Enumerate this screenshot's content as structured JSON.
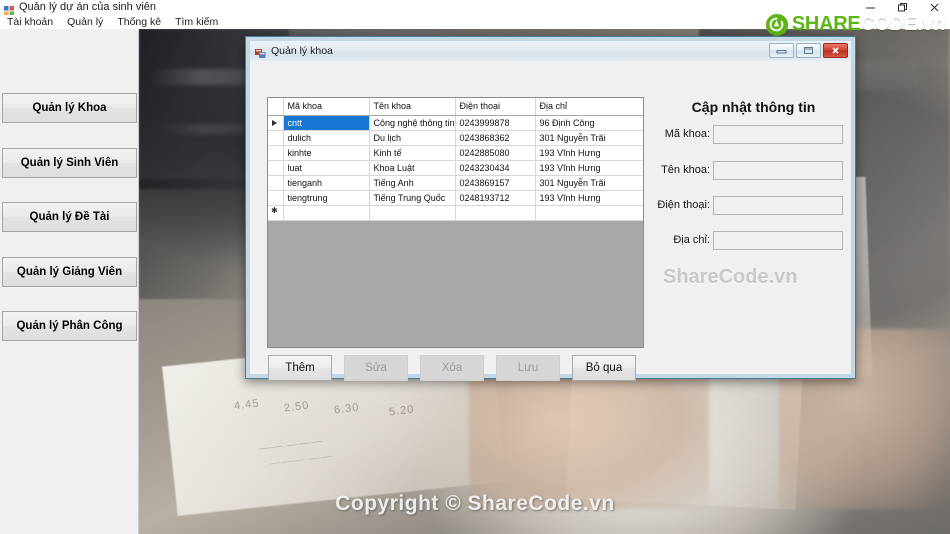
{
  "main_window": {
    "title": "Quản lý dự án của sinh viên",
    "icon": "app-icon",
    "controls": {
      "minimize": "—",
      "maximize": "❐",
      "close": "✕"
    },
    "menu": [
      {
        "label": "Tài khoản"
      },
      {
        "label": "Quản lý"
      },
      {
        "label": "Thống kê"
      },
      {
        "label": "Tìm kiếm"
      }
    ]
  },
  "sidebar": {
    "items": [
      {
        "label": "Quản lý Khoa"
      },
      {
        "label": "Quản lý Sinh Viên"
      },
      {
        "label": "Quản lý Đề Tài"
      },
      {
        "label": "Quản lý Giảng Viên"
      },
      {
        "label": "Quản lý Phân Công"
      }
    ]
  },
  "watermarks": {
    "logo_share": "SHARE",
    "logo_code": "CODE.vn",
    "center": "ShareCode.vn",
    "panel": "ShareCode.vn",
    "copyright": "Copyright © ShareCode.vn"
  },
  "dialog": {
    "title": "Quản lý khoa",
    "icon": "form-icon",
    "controls": {
      "minimize": "—",
      "maximize": "❐",
      "close": "✕"
    },
    "grid": {
      "columns": [
        "Mã khoa",
        "Tên khoa",
        "Điện thoại",
        "Địa chỉ"
      ],
      "rows": [
        {
          "ma_khoa": "cntt",
          "ten_khoa": "Công nghệ thông tin",
          "dien_thoai": "0243999878",
          "dia_chi": "96 Định Công",
          "selected": true
        },
        {
          "ma_khoa": "dulich",
          "ten_khoa": "Du lịch",
          "dien_thoai": "0243868362",
          "dia_chi": "301 Nguyễn Trãi",
          "selected": false
        },
        {
          "ma_khoa": "kinhte",
          "ten_khoa": "Kinh tế",
          "dien_thoai": "0242885080",
          "dia_chi": "193 Vĩnh Hưng",
          "selected": false
        },
        {
          "ma_khoa": "luat",
          "ten_khoa": "Khoa Luật",
          "dien_thoai": "0243230434",
          "dia_chi": "193 Vĩnh Hưng",
          "selected": false
        },
        {
          "ma_khoa": "tienganh",
          "ten_khoa": "Tiếng Anh",
          "dien_thoai": "0243869157",
          "dia_chi": "301 Nguyễn Trãi",
          "selected": false
        },
        {
          "ma_khoa": "tiengtrung",
          "ten_khoa": "Tiếng Trung Quốc",
          "dien_thoai": "0248193712",
          "dia_chi": "193 Vĩnh Hưng",
          "selected": false
        },
        {
          "ma_khoa": "",
          "ten_khoa": "",
          "dien_thoai": "",
          "dia_chi": "",
          "selected": false
        }
      ]
    },
    "form": {
      "title": "Cập nhật thông tin",
      "fields": [
        {
          "label": "Mã khoa:",
          "value": ""
        },
        {
          "label": "Tên khoa:",
          "value": ""
        },
        {
          "label": "Điện thoại:",
          "value": ""
        },
        {
          "label": "Địa chỉ:",
          "value": ""
        }
      ]
    },
    "actions": [
      {
        "label": "Thêm",
        "enabled": true
      },
      {
        "label": "Sửa",
        "enabled": false
      },
      {
        "label": "Xóa",
        "enabled": false
      },
      {
        "label": "Lưu",
        "enabled": false
      },
      {
        "label": "Bỏ qua",
        "enabled": true
      }
    ]
  },
  "colors": {
    "selection_blue": "#1977d4",
    "brand_green": "#5eb616",
    "sidebar_bg": "#f0f0f0",
    "grid_empty": "#a8a8a8"
  }
}
